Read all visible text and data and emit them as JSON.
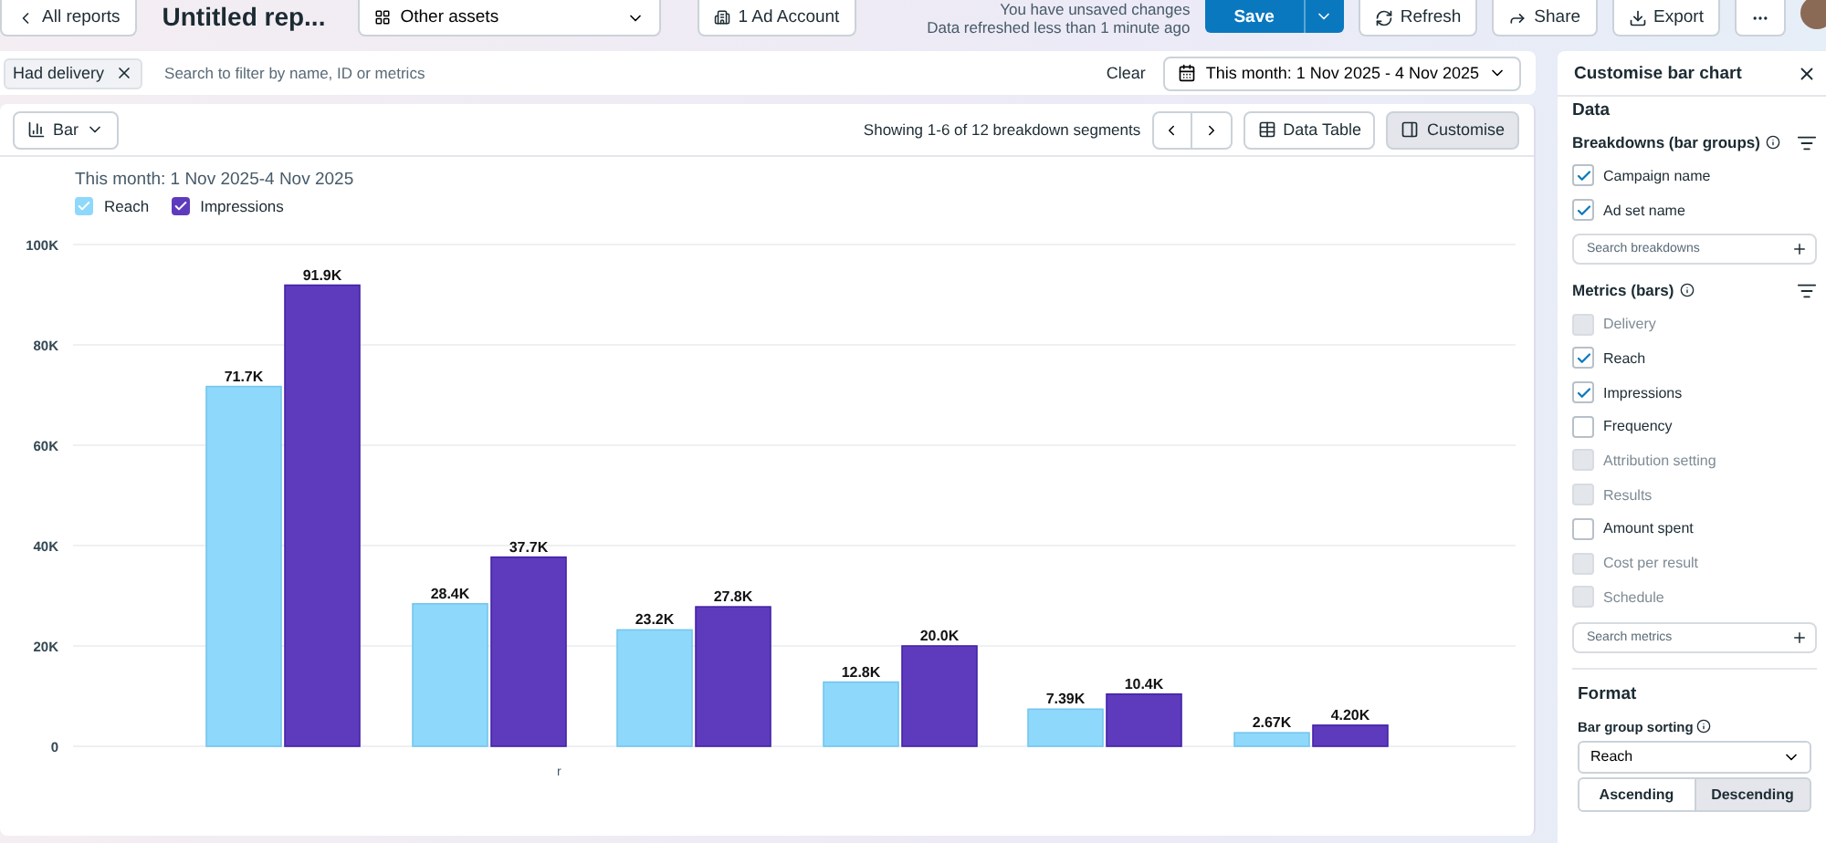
{
  "top_bar": {
    "back_button": "All reports",
    "report_title": "Untitled rep...",
    "assets_dropdown": "Other assets",
    "account_button": "1 Ad Account",
    "status": "You have unsaved changes",
    "refresh_note": "Data refreshed less than 1 minute ago",
    "buttons": [
      "Save",
      "Refresh",
      "Share",
      "Export"
    ]
  },
  "filter_bar": {
    "chip": "Had delivery",
    "placeholder": "Search to filter by name, ID or metrics",
    "clear": "Clear",
    "date_range": "This month: 1 Nov 2025 - 4 Nov 2025"
  },
  "toolbar": {
    "chart_type": "Bar",
    "paging": "Showing 1-6 of 12 breakdown segments",
    "buttons": [
      {
        "label": "Data Table",
        "selected": false
      },
      {
        "label": "Customise",
        "selected": true
      }
    ]
  },
  "chart": {
    "subtitle": "This month: 1 Nov 2025-4 Nov 2025",
    "x_axis_fragment": "r",
    "chart_data": {
      "type": "bar",
      "categories": [
        null,
        null,
        null,
        null,
        null,
        null
      ],
      "grid": true,
      "series": [
        {
          "name": "Reach",
          "color": "#8ed8fb",
          "values": [
            71700,
            28400,
            23200,
            12800,
            7400,
            2700
          ]
        },
        {
          "name": "Impressions",
          "color": "#5e3bbd",
          "values": [
            91900,
            37700,
            27800,
            20000,
            10400,
            4200
          ]
        }
      ],
      "ylim": [
        0,
        100000
      ],
      "yticks": [
        {
          "value": 0,
          "label": "0"
        },
        {
          "value": 20000,
          "label": "20K"
        },
        {
          "value": 40000,
          "label": "40K"
        },
        {
          "value": 60000,
          "label": "60K"
        },
        {
          "value": 80000,
          "label": "80K"
        },
        {
          "value": 100000,
          "label": "100K"
        }
      ],
      "value_labels": [
        [
          "71.7K",
          "28.4K",
          "23.2K",
          "12.8K",
          "7.39K",
          "2.67K"
        ],
        [
          "91.9K",
          "37.7K",
          "27.8K",
          "20.0K",
          "10.4K",
          "4.20K"
        ]
      ]
    }
  },
  "panel": {
    "title": "Customise bar chart",
    "section": "Data",
    "breakdowns": {
      "heading": "Breakdowns (bar groups)",
      "items": [
        {
          "label": "Campaign name",
          "checked": true,
          "disabled": false
        },
        {
          "label": "Ad set name",
          "checked": true,
          "disabled": false
        }
      ],
      "placeholder": "Search breakdowns"
    },
    "metrics": {
      "heading": "Metrics (bars)",
      "items": [
        {
          "label": "Delivery",
          "checked": false,
          "disabled": true
        },
        {
          "label": "Reach",
          "checked": true,
          "disabled": false
        },
        {
          "label": "Impressions",
          "checked": true,
          "disabled": false
        },
        {
          "label": "Frequency",
          "checked": false,
          "disabled": false
        },
        {
          "label": "Attribution setting",
          "checked": false,
          "disabled": true
        },
        {
          "label": "Results",
          "checked": false,
          "disabled": true
        },
        {
          "label": "Amount spent",
          "checked": false,
          "disabled": false
        },
        {
          "label": "Cost per result",
          "checked": false,
          "disabled": true
        },
        {
          "label": "Schedule",
          "checked": false,
          "disabled": true
        }
      ],
      "placeholder": "Search metrics"
    },
    "format": {
      "heading": "Format",
      "sorting_label": "Bar group sorting",
      "sorting_value": "Reach",
      "order": [
        {
          "label": "Ascending",
          "selected": false
        },
        {
          "label": "Descending",
          "selected": true
        }
      ]
    }
  }
}
